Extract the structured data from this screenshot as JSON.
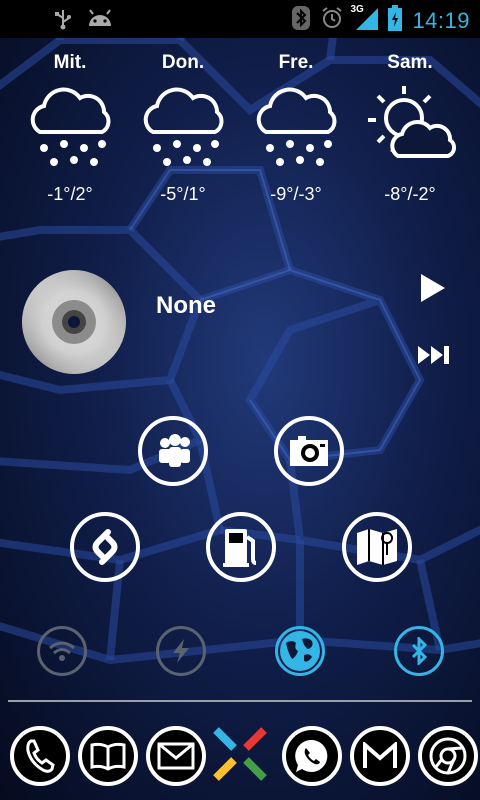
{
  "status_bar": {
    "time": "14:19",
    "network": "3G",
    "icons_left": [
      "usb-icon",
      "android-icon"
    ],
    "icons_right": [
      "bluetooth-icon",
      "alarm-icon",
      "signal-icon",
      "battery-charging-icon"
    ]
  },
  "weather": {
    "days": [
      {
        "day": "Mit.",
        "temp": "-1°/2°",
        "condition": "snow-cloud-icon"
      },
      {
        "day": "Don.",
        "temp": "-5°/1°",
        "condition": "snow-cloud-icon"
      },
      {
        "day": "Fre.",
        "temp": "-9°/-3°",
        "condition": "snow-cloud-icon"
      },
      {
        "day": "Sam.",
        "temp": "-8°/-2°",
        "condition": "sun-cloud-icon"
      }
    ]
  },
  "music": {
    "track": "None"
  },
  "apps": [
    "myspace-icon",
    "camera-icon",
    "shazam-icon",
    "fuel-icon",
    "maps-icon"
  ],
  "toggles": {
    "wifi": {
      "color": "#5a6272"
    },
    "flash": {
      "color": "#5a6272"
    },
    "data": {
      "color": "#33b5e5"
    },
    "bluetooth": {
      "color": "#33b5e5"
    }
  },
  "dock": [
    "phone-icon",
    "book-icon",
    "mail-icon",
    "app-drawer-icon",
    "whatsapp-icon",
    "gmail-icon",
    "chrome-icon"
  ],
  "colors": {
    "accent": "#33b5e5",
    "inactive": "#5a6272"
  }
}
